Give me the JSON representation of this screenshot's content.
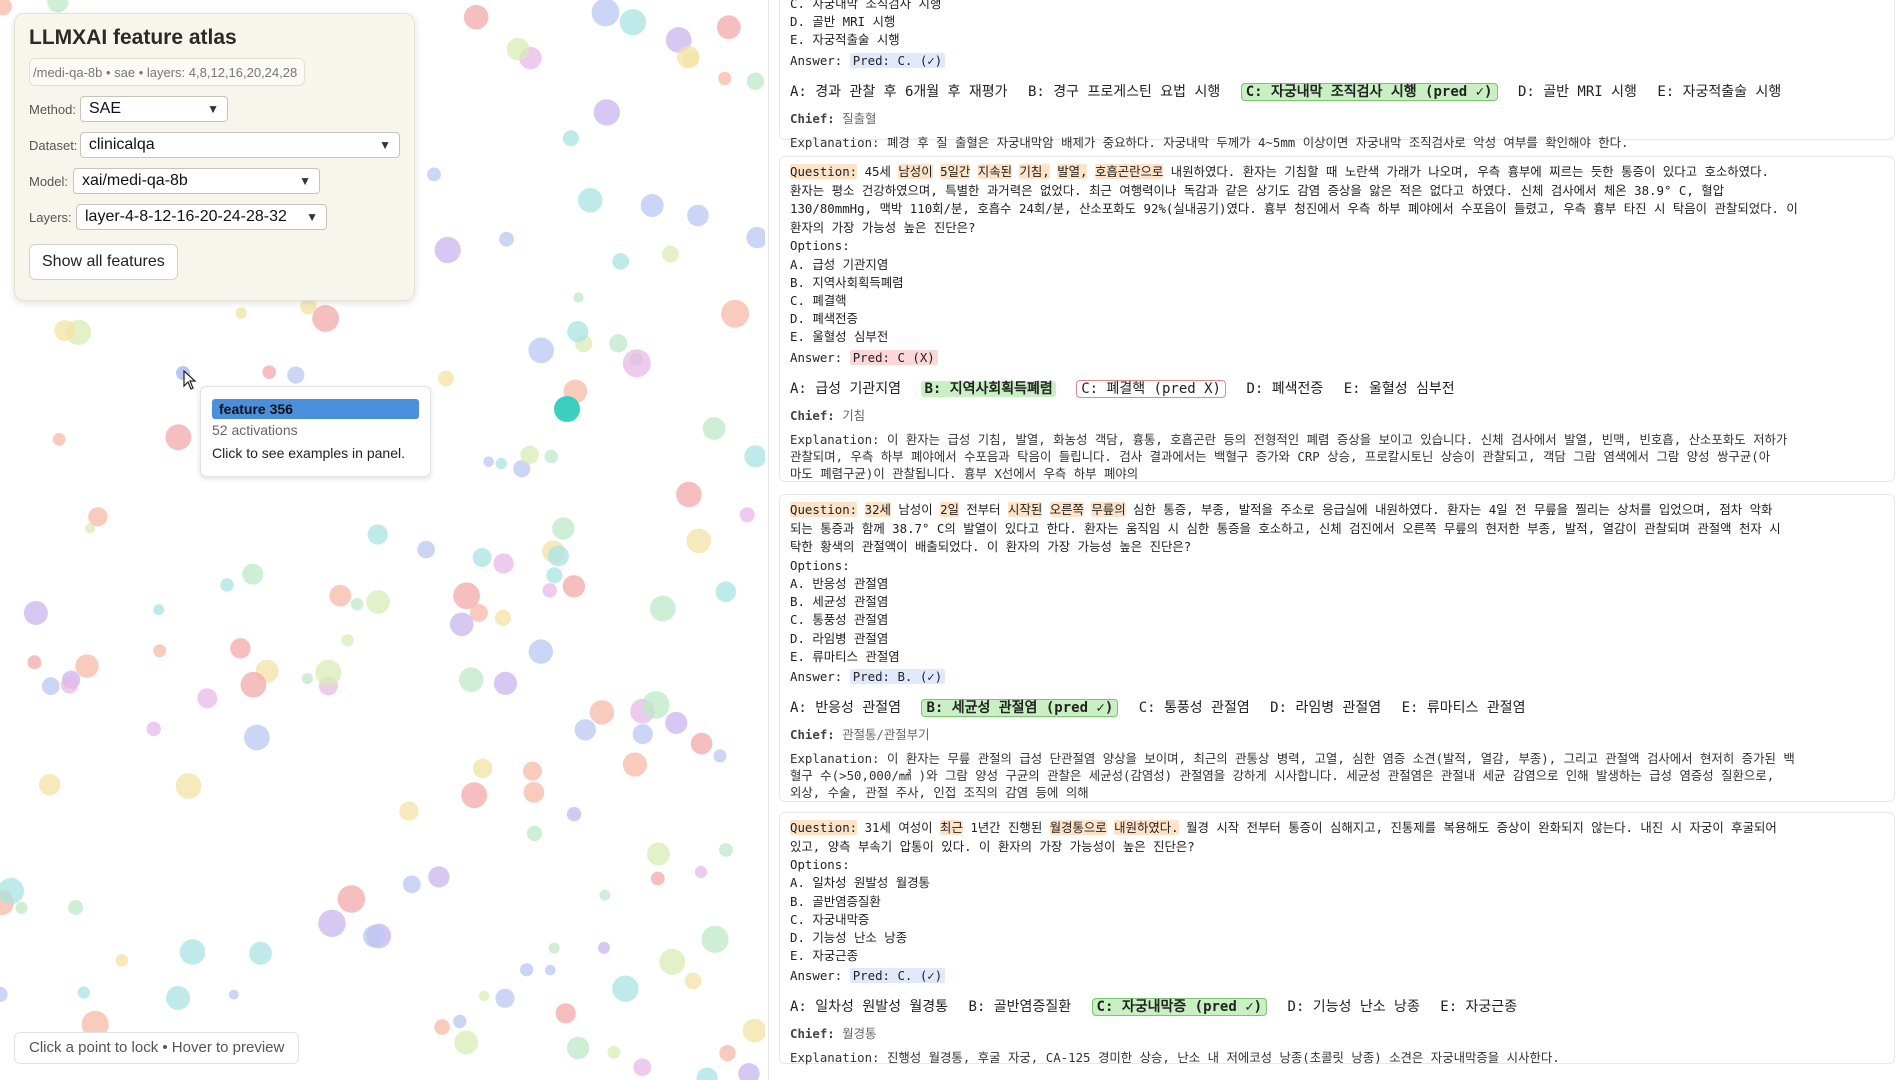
{
  "control_panel": {
    "title": "LLMXAI feature atlas",
    "subtitle": "/medi-qa-8b • sae • layers: 4,8,12,16,20,24,28",
    "method_label": "Method:",
    "method_value": "SAE",
    "dataset_label": "Dataset:",
    "dataset_value": "clinicalqa",
    "model_label": "Model:",
    "model_value": "xai/medi-qa-8b",
    "layers_label": "Layers:",
    "layers_value": "layer-4-8-12-16-20-24-28-32",
    "show_all_label": "Show all features"
  },
  "tooltip": {
    "feature": "feature 356",
    "count": "52 activations",
    "hint": "Click to see examples in panel."
  },
  "footer_hint": "Click a point to lock • Hover to preview",
  "icons": {
    "cursor": "pointer-cursor-icon",
    "dropdown": "chevron-down-icon"
  },
  "colors": {
    "accent": "#4a8fdc",
    "correct": "#c9f0c3",
    "wrong": "#fbd7d7",
    "highlight": "#fde3c8",
    "pred_ok": "#dfe9fb"
  },
  "examples": [
    {
      "top_lines": [
        "C. 자궁내막 조직검사 시행",
        "D. 골반 MRI 시행",
        "E. 자궁적출술 시행"
      ],
      "answer_label": "Answer:",
      "answer_pred": "Pred: C. (✓)",
      "options_row": [
        "A: 경과 관찰 후 6개월 후 재평가",
        "B: 경구 프로게스틴 요법 시행",
        "C: 자궁내막 조직검사 시행 (pred ✓)",
        "D: 골반 MRI 시행",
        "E: 자궁적출술 시행"
      ],
      "chief_label": "Chief:",
      "chief": "질출혈",
      "explanation": "Explanation: 폐경 후 질 출혈은 자궁내막암 배제가 중요하다. 자궁내막 두께가 4~5mm 이상이면 자궁내막 조직검사로 악성 여부를 확인해야 한다."
    },
    {
      "question_lines": [
        "Question: 45세 남성이 5일간 지속된 기침, 발열, 호흡곤란으로 내원하였다. 환자는 기침할 때 노란색 가래가 나오며, 우측 흉부에 찌르는 듯한 통증이 있다고 호소하였다.",
        "환자는 평소 건강하였으며, 특별한 과거력은 없었다. 최근 여행력이나 독감과 같은 상기도 감염 증상을 앓은 적은 없다고 하였다. 신체 검사에서 체온 38.9° C, 혈압",
        "130/80mmHg, 맥박 110회/분, 호흡수 24회/분, 산소포화도 92%(실내공기)였다. 흉부 청진에서 우측 하부 폐야에서 수포음이 들렸고, 우측 흉부 타진 시 탁음이 관찰되었다. 이",
        "환자의 가장 가능성 높은 진단은?"
      ],
      "options_label": "Options:",
      "options": [
        "A. 급성 기관지염",
        "B. 지역사회획득폐렴",
        "C. 폐결핵",
        "D. 폐색전증",
        "E. 울혈성 심부전"
      ],
      "answer_label": "Answer:",
      "answer_pred": "Pred: C (X)",
      "options_row": [
        "A: 급성 기관지염",
        "B: 지역사회획득폐렴",
        "C: 폐결핵 (pred X)",
        "D: 폐색전증",
        "E: 울혈성 심부전"
      ],
      "chief_label": "Chief:",
      "chief": "기침",
      "explanation_lines": [
        "Explanation: 이 환자는 급성 기침, 발열, 화농성 객담, 흉통, 호흡곤란 등의 전형적인 폐렴 증상을 보이고 있습니다. 신체 검사에서 발열, 빈맥, 빈호흡, 산소포화도 저하가",
        "관찰되며, 우측 하부 폐야에서 수포음과 탁음이 들립니다. 검사 결과에서는 백혈구 증가와 CRP 상승, 프로칼시토닌 상승이 관찰되고, 객담 그람 염색에서 그람 양성 쌍구균(아",
        "마도 폐렴구균)이 관찰됩니다. 흉부 X선에서 우측 하부 폐야의"
      ]
    },
    {
      "question_lines": [
        "Question: 32세 남성이 2일 전부터 시작된 오른쪽 무릎의 심한 통증, 부종, 발적을 주소로 응급실에 내원하였다. 환자는 4일 전 무릎을 찔리는 상처를 입었으며, 점차 악화",
        "되는 통증과 함께 38.7° C의 발열이 있다고 한다. 환자는 움직임 시 심한 통증을 호소하고, 신체 검진에서 오른쪽 무릎의 현저한 부종, 발적, 열감이 관찰되며 관절액 천자 시",
        "탁한 황색의 관절액이 배출되었다. 이 환자의 가장 가능성 높은 진단은?"
      ],
      "options_label": "Options:",
      "options": [
        "A. 반응성 관절염",
        "B. 세균성 관절염",
        "C. 통풍성 관절염",
        "D. 라임병 관절염",
        "E. 류마티스 관절염"
      ],
      "answer_label": "Answer:",
      "answer_pred": "Pred: B. (✓)",
      "options_row": [
        "A: 반응성 관절염",
        "B: 세균성 관절염 (pred ✓)",
        "C: 통풍성 관절염",
        "D: 라임병 관절염",
        "E: 류마티스 관절염"
      ],
      "chief_label": "Chief:",
      "chief": "관절통/관절부기",
      "explanation_lines": [
        "Explanation: 이 환자는 무릎 관절의 급성 단관절염 양상을 보이며, 최근의 관통상 병력, 고열, 심한 염증 소견(발적, 열감, 부종), 그리고 관절액 검사에서 현저히 증가된 백",
        "혈구 수(>50,000/㎣ )와 그람 양성 구균의 관찰은 세균성(감염성) 관절염을 강하게 시사합니다. 세균성 관절염은 관절내 세균 감염으로 인해 발생하는 급성 염증성 질환으로,",
        "외상, 수술, 관절 주사, 인접 조직의 감염 등에 의해"
      ]
    },
    {
      "question_lines": [
        "Question: 31세 여성이 최근 1년간 진행된 월경통으로 내원하였다. 월경 시작 전부터 통증이 심해지고, 진통제를 복용해도 증상이 완화되지 않는다. 내진 시 자궁이 후굴되어",
        "있고, 양측 부속기 압통이 있다. 이 환자의 가장 가능성이 높은 진단은?"
      ],
      "options_label": "Options:",
      "options": [
        "A. 일차성 원발성 월경통",
        "B. 골반염증질환",
        "C. 자궁내막증",
        "D. 기능성 난소 낭종",
        "E. 자궁근종"
      ],
      "answer_label": "Answer:",
      "answer_pred": "Pred: C. (✓)",
      "options_row": [
        "A: 일차성 원발성 월경통",
        "B: 골반염증질환",
        "C: 자궁내막증 (pred ✓)",
        "D: 기능성 난소 낭종",
        "E: 자궁근종"
      ],
      "chief_label": "Chief:",
      "chief": "월경통",
      "explanation": "Explanation: 진행성 월경통, 후굴 자궁, CA-125 경미한 상승, 난소 내 저에코성 낭종(초콜릿 낭종) 소견은 자궁내막증을 시사한다."
    }
  ]
}
